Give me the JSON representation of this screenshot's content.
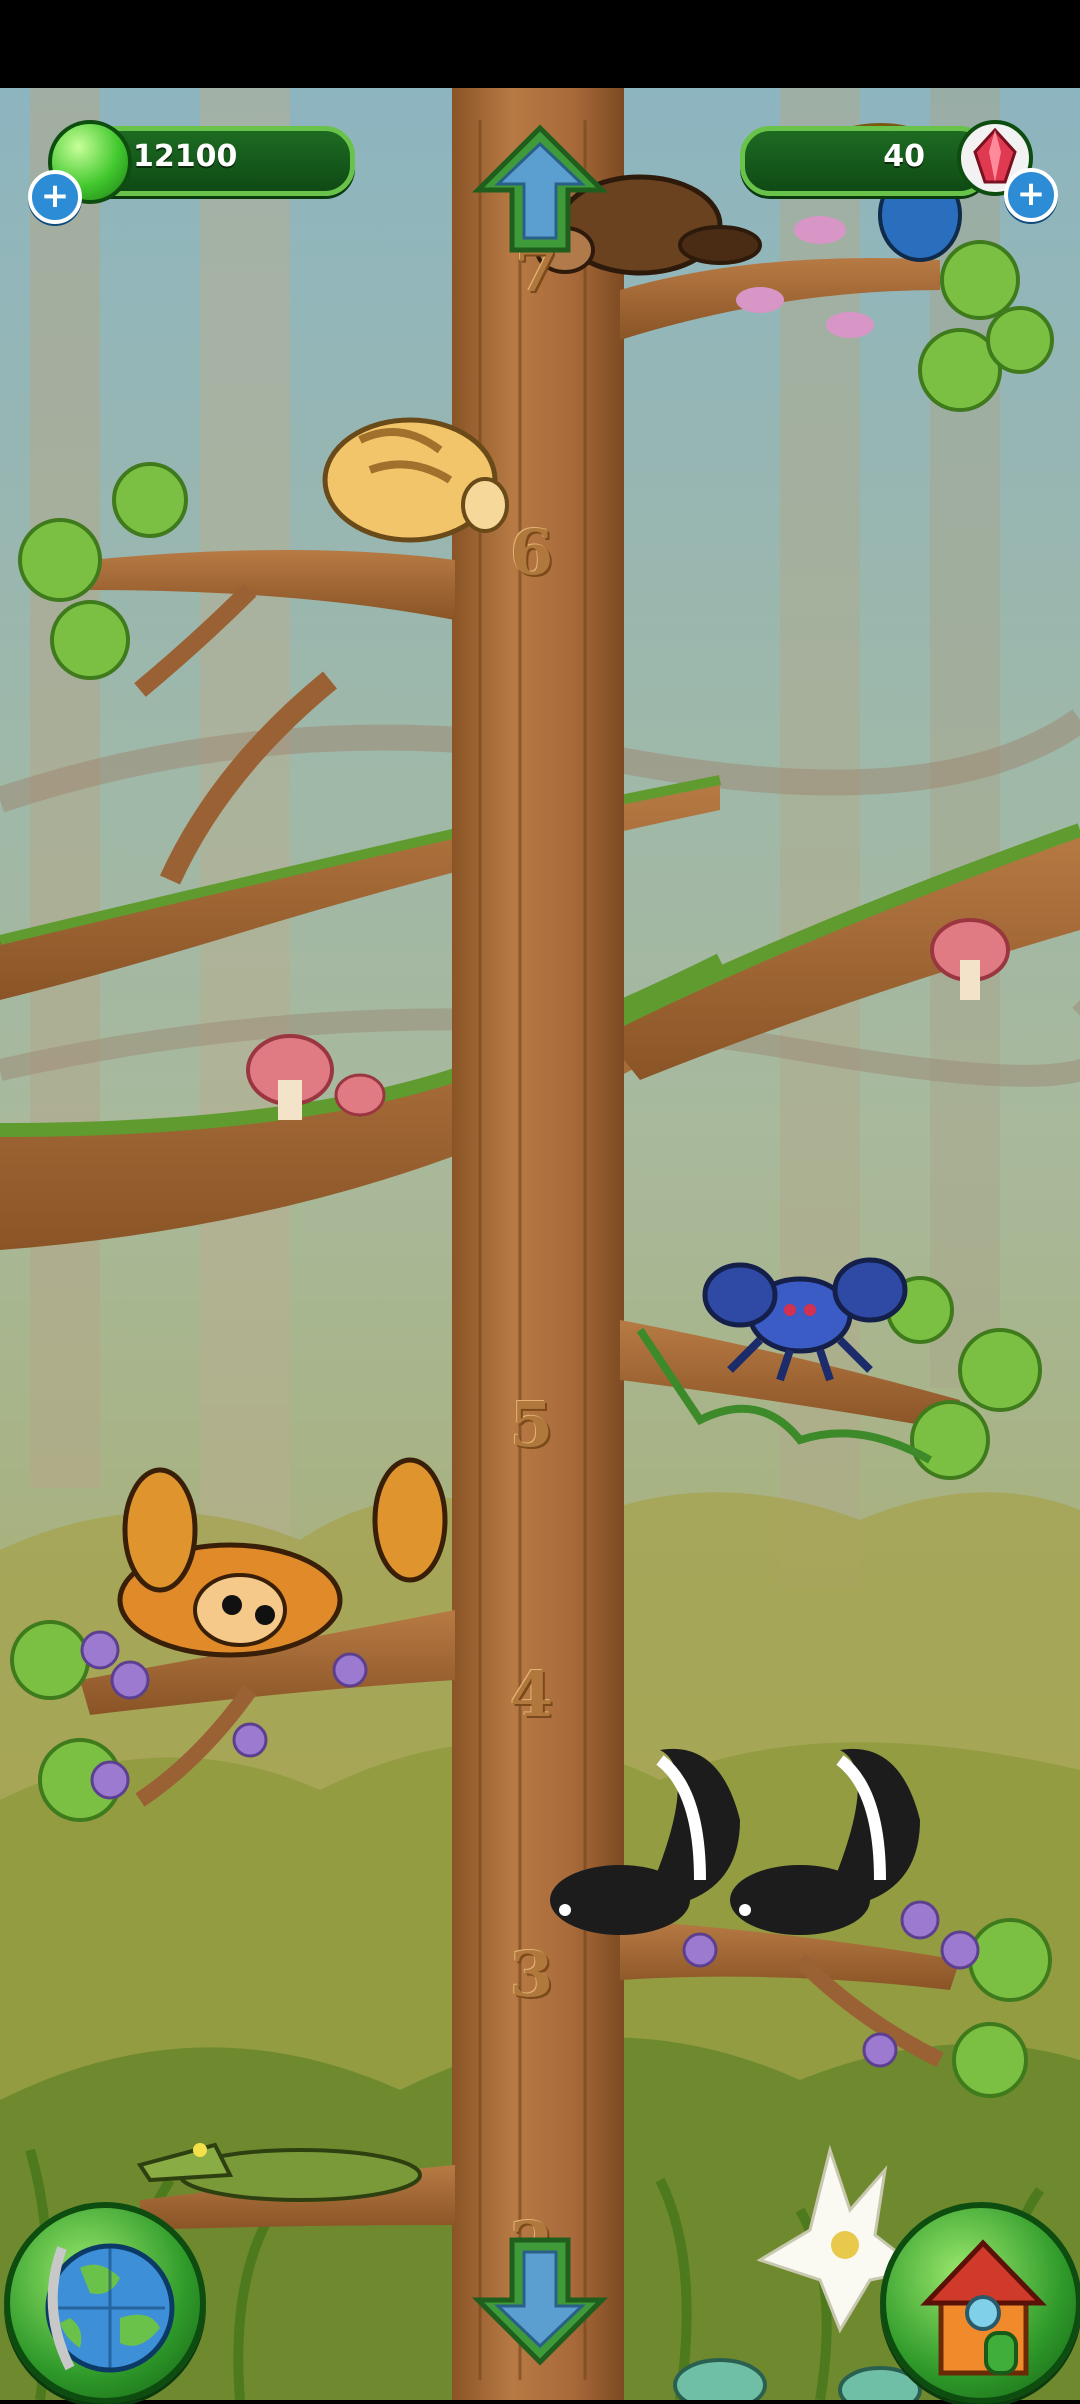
{
  "hud": {
    "coins": "12100",
    "gems": "40"
  },
  "floors": [
    "7",
    "6",
    "5",
    "4",
    "3",
    "2"
  ],
  "icons": {
    "coin": "green-gem-coin-icon",
    "gem": "red-crystal-icon",
    "add": "plus-icon",
    "up": "arrow-up-icon",
    "down": "arrow-down-icon",
    "map": "globe-icon",
    "home": "house-icon"
  },
  "colors": {
    "trunk": "#a86a3a",
    "pill": "#1d6b22",
    "pill_border": "#69c24a",
    "plus": "#2d8cd6",
    "sky": "#8fb7c2"
  }
}
